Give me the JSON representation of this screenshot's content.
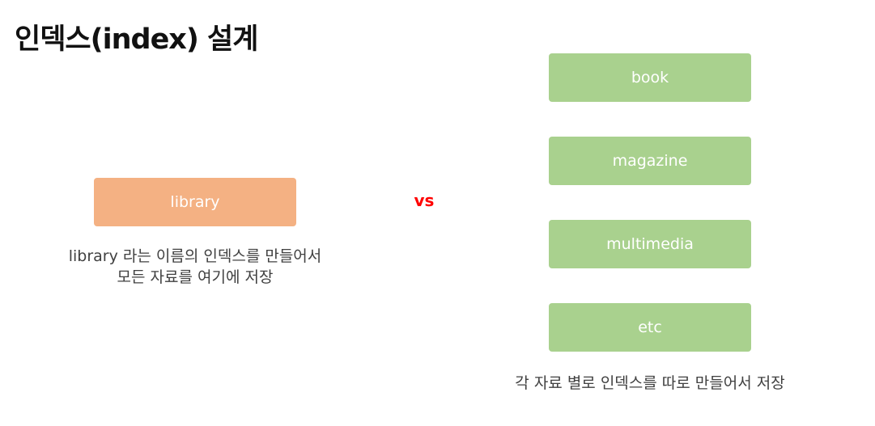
{
  "title": "인덱스(index) 설계",
  "left": {
    "index_label": "library",
    "caption_line1": "library 라는 이름의 인덱스를 만들어서",
    "caption_line2": "모든 자료를 여기에 저장",
    "box_color": "#F4B183"
  },
  "versus": {
    "label": "vs",
    "color": "#FF0000"
  },
  "right": {
    "indices": [
      "book",
      "magazine",
      "multimedia",
      "etc"
    ],
    "caption": "각 자료 별로 인덱스를 따로 만들어서 저장",
    "box_color": "#A9D18E"
  }
}
